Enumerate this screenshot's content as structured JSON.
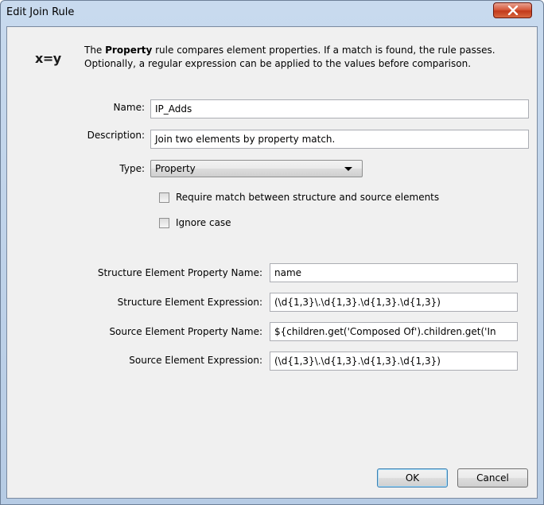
{
  "window": {
    "title": "Edit Join Rule"
  },
  "header": {
    "icon_text": "x=y",
    "desc_prefix": "The ",
    "desc_bold": "Property",
    "desc_line1_rest": " rule compares element properties. If a match is found, the rule passes.",
    "desc_line2": "Optionally, a regular expression can be applied to the values before comparison."
  },
  "form": {
    "name_label": "Name:",
    "name_value": "IP_Adds",
    "description_label": "Description:",
    "description_value": "Join two elements by property match.",
    "type_label": "Type:",
    "type_value": "Property",
    "require_match_label": "Require match between structure and source elements",
    "require_match_checked": false,
    "ignore_case_label": "Ignore case",
    "ignore_case_checked": false
  },
  "properties": {
    "structure_prop_label": "Structure Element Property Name:",
    "structure_prop_value": "name",
    "structure_expr_label": "Structure Element Expression:",
    "structure_expr_value": "(\\d{1,3}\\.\\d{1,3}.\\d{1,3}.\\d{1,3})",
    "source_prop_label": "Source Element Property Name:",
    "source_prop_value": "${children.get('Composed Of').children.get('In",
    "source_expr_label": "Source Element Expression:",
    "source_expr_value": "(\\d{1,3}\\.\\d{1,3}.\\d{1,3}.\\d{1,3})"
  },
  "buttons": {
    "ok": "OK",
    "cancel": "Cancel"
  }
}
